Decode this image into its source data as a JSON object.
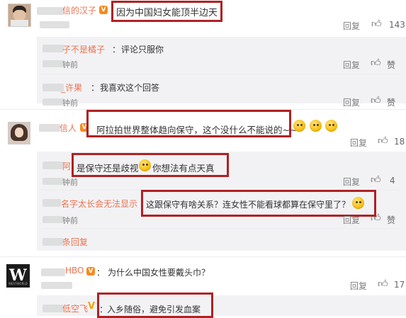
{
  "comments": [
    {
      "name": "信的汉子",
      "text": "因为中国妇女能顶半边天",
      "reply_label": "回复",
      "likes": "143",
      "replies": [
        {
          "name": "子不是橘子",
          "text": "评论只服你",
          "time": "钟前",
          "reply_label": "回复",
          "like_label": "赞"
        },
        {
          "name": "_许果",
          "text": "我喜欢这个回答",
          "time": "钟前",
          "reply_label": "回复",
          "like_label": "赞"
        }
      ]
    },
    {
      "name": "信人",
      "text": "阿拉拍世界整体趋向保守，这个没什么不能说的~~",
      "reply_label": "回复",
      "likes": "18",
      "replies": [
        {
          "name": "阿",
          "text": "是保守还是歧视",
          "text2": "你想法有点天真",
          "time": "钟前",
          "reply_label": "回复",
          "likes": "4"
        },
        {
          "name": "名字太长会无法显示",
          "text": "这跟保守有啥关系？连女性不能看球都算在保守里了？",
          "time": "钟前",
          "reply_label": "回复",
          "like_label": "赞"
        }
      ],
      "more_replies": "条回复"
    },
    {
      "name": "HBO",
      "text": "为什么中国女性要戴头巾？",
      "reply_label": "回复",
      "likes": "17",
      "replies": [
        {
          "name": "低空飞",
          "text": "入乡随俗，避免引发血案"
        }
      ]
    }
  ],
  "colors": {
    "username": "#eb7350",
    "highlight_box": "#b02123",
    "meta": "#808080"
  },
  "icons": [
    "thumbs-up-icon",
    "vip-icon",
    "smile-emoji-icon",
    "v-badge-icon"
  ]
}
